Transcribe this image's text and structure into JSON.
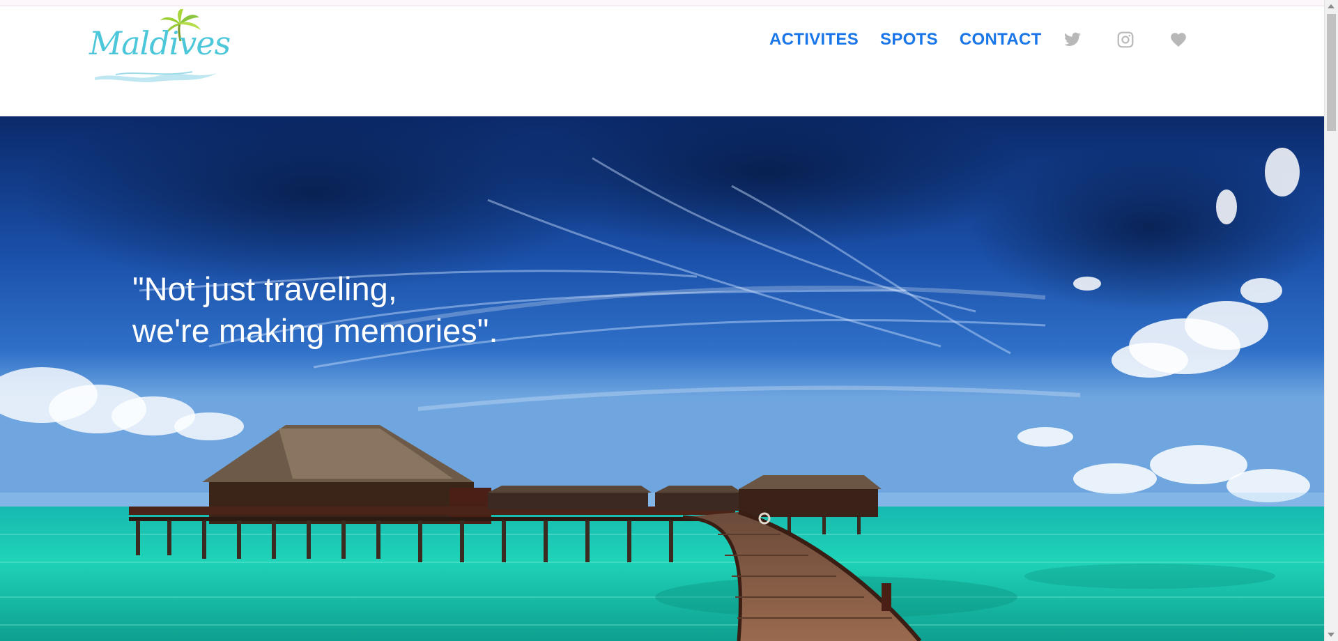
{
  "brand": {
    "logo_text": "Maldives",
    "logo_icon": "palm-tree-icon"
  },
  "nav": {
    "links": [
      {
        "label": "ACTIVITES"
      },
      {
        "label": "SPOTS"
      },
      {
        "label": "CONTACT"
      }
    ],
    "icons": [
      {
        "name": "twitter-icon"
      },
      {
        "name": "instagram-icon"
      },
      {
        "name": "heart-icon"
      }
    ],
    "link_color": "#1976e8",
    "icon_color": "#b8b8b8"
  },
  "hero": {
    "quote_line1": "\"Not just traveling,",
    "quote_line2": "we're making memories\".",
    "scene": "overwater-bungalows-pier"
  }
}
